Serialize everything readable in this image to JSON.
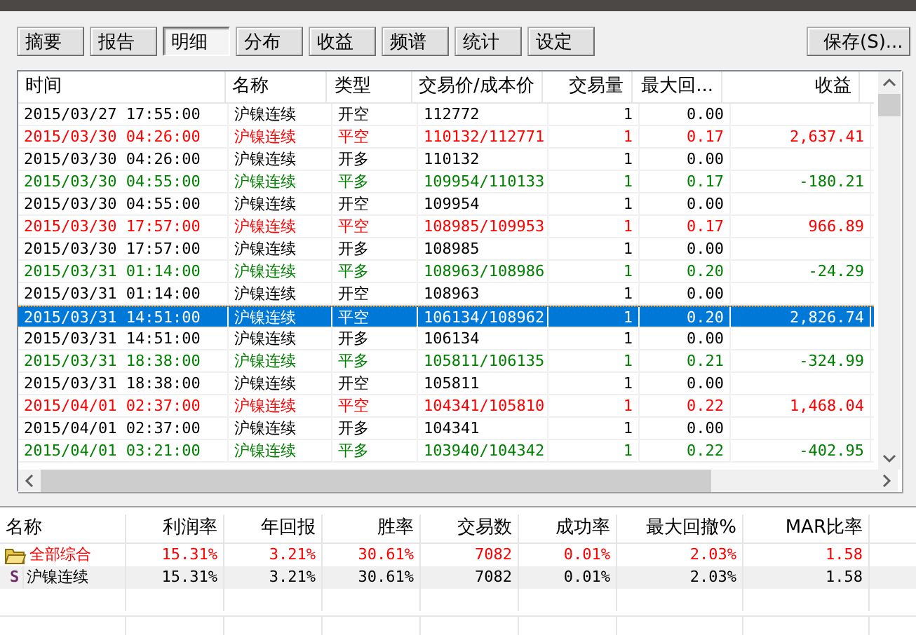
{
  "tabs": [
    {
      "label": "摘要",
      "selected": false
    },
    {
      "label": "报告",
      "selected": false
    },
    {
      "label": "明细",
      "selected": true
    },
    {
      "label": "分布",
      "selected": false
    },
    {
      "label": "收益",
      "selected": false
    },
    {
      "label": "频谱",
      "selected": false
    },
    {
      "label": "统计",
      "selected": false
    },
    {
      "label": "设定",
      "selected": false
    }
  ],
  "save_button": "保存(S)...",
  "trades": {
    "columns": [
      "时间",
      "名称",
      "类型",
      "交易价/成本价",
      "交易量",
      "最大回...",
      "收益"
    ],
    "rows": [
      {
        "time": "2015/03/27 17:55:00",
        "name": "沪镍连续",
        "type": "开空",
        "price": "112772",
        "qty": "1",
        "drawdown": "0.00",
        "color": "#000000",
        "selected": false
      },
      {
        "time": "2015/03/30 04:26:00",
        "name": "沪镍连续",
        "type": "平空",
        "price": "110132/112771",
        "qty": "1",
        "drawdown": "0.17",
        "profit": "2,637.41",
        "color": "#ff0000",
        "selected": false
      },
      {
        "time": "2015/03/30 04:26:00",
        "name": "沪镍连续",
        "type": "开多",
        "price": "110132",
        "qty": "1",
        "drawdown": "0.00",
        "color": "#000000",
        "selected": false
      },
      {
        "time": "2015/03/30 04:55:00",
        "name": "沪镍连续",
        "type": "平多",
        "price": "109954/110133",
        "qty": "1",
        "drawdown": "0.17",
        "profit": "-180.21",
        "color": "#008000",
        "selected": false
      },
      {
        "time": "2015/03/30 04:55:00",
        "name": "沪镍连续",
        "type": "开空",
        "price": "109954",
        "qty": "1",
        "drawdown": "0.00",
        "color": "#000000",
        "selected": false
      },
      {
        "time": "2015/03/30 17:57:00",
        "name": "沪镍连续",
        "type": "平空",
        "price": "108985/109953",
        "qty": "1",
        "drawdown": "0.17",
        "profit": "966.89",
        "color": "#ff0000",
        "selected": false
      },
      {
        "time": "2015/03/30 17:57:00",
        "name": "沪镍连续",
        "type": "开多",
        "price": "108985",
        "qty": "1",
        "drawdown": "0.00",
        "color": "#000000",
        "selected": false
      },
      {
        "time": "2015/03/31 01:14:00",
        "name": "沪镍连续",
        "type": "平多",
        "price": "108963/108986",
        "qty": "1",
        "drawdown": "0.20",
        "profit": "-24.29",
        "color": "#008000",
        "selected": false
      },
      {
        "time": "2015/03/31 01:14:00",
        "name": "沪镍连续",
        "type": "开空",
        "price": "108963",
        "qty": "1",
        "drawdown": "0.00",
        "color": "#000000",
        "selected": false
      },
      {
        "time": "2015/03/31 14:51:00",
        "name": "沪镍连续",
        "type": "平空",
        "price": "106134/108962",
        "qty": "1",
        "drawdown": "0.20",
        "profit": "2,826.74",
        "selected": true
      },
      {
        "time": "2015/03/31 14:51:00",
        "name": "沪镍连续",
        "type": "开多",
        "price": "106134",
        "qty": "1",
        "drawdown": "0.00",
        "color": "#000000",
        "selected": false
      },
      {
        "time": "2015/03/31 18:38:00",
        "name": "沪镍连续",
        "type": "平多",
        "price": "105811/106135",
        "qty": "1",
        "drawdown": "0.21",
        "profit": "-324.99",
        "color": "#008000",
        "selected": false
      },
      {
        "time": "2015/03/31 18:38:00",
        "name": "沪镍连续",
        "type": "开空",
        "price": "105811",
        "qty": "1",
        "drawdown": "0.00",
        "color": "#000000",
        "selected": false
      },
      {
        "time": "2015/04/01 02:37:00",
        "name": "沪镍连续",
        "type": "平空",
        "price": "104341/105810",
        "qty": "1",
        "drawdown": "0.22",
        "profit": "1,468.04",
        "color": "#ff0000",
        "selected": false
      },
      {
        "time": "2015/04/01 02:37:00",
        "name": "沪镍连续",
        "type": "开多",
        "price": "104341",
        "qty": "1",
        "drawdown": "0.00",
        "color": "#000000",
        "selected": false
      },
      {
        "time": "2015/04/01 03:21:00",
        "name": "沪镍连续",
        "type": "平多",
        "price": "103940/104342",
        "qty": "1",
        "drawdown": "0.22",
        "profit": "-402.95",
        "color": "#008000",
        "selected": false
      }
    ]
  },
  "summary": {
    "columns": [
      "名称",
      "利润率",
      "年回报",
      "胜率",
      "交易数",
      "成功率",
      "最大回撤%",
      "MAR比率"
    ],
    "rows": [
      {
        "kind": "group",
        "color": "#ff0000",
        "cells": [
          "全部综合",
          "15.31%",
          "3.21%",
          "30.61%",
          "7082",
          "0.01%",
          "2.03%",
          "1.58"
        ]
      },
      {
        "kind": "symbol",
        "icon": "S",
        "color": "#000000",
        "cells": [
          "沪镍连续",
          "15.31%",
          "3.21%",
          "30.61%",
          "7082",
          "0.01%",
          "2.03%",
          "1.58"
        ]
      }
    ]
  }
}
